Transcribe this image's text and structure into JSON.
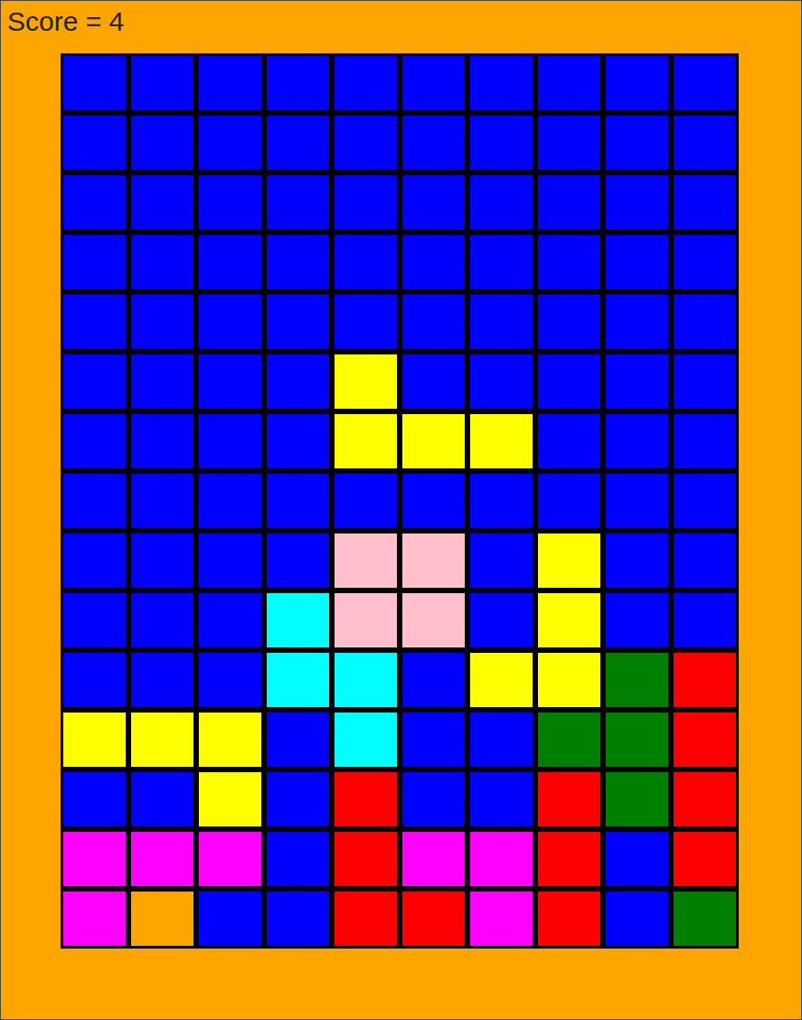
{
  "score": "Score = 4",
  "board": {
    "rows": [
      [
        "#0000ff",
        "#0000ff",
        "#0000ff",
        "#0000ff",
        "#0000ff",
        "#0000ff",
        "#0000ff",
        "#0000ff",
        "#0000ff",
        "#0000ff"
      ],
      [
        "#0000ff",
        "#0000ff",
        "#0000ff",
        "#0000ff",
        "#0000ff",
        "#0000ff",
        "#0000ff",
        "#0000ff",
        "#0000ff",
        "#0000ff"
      ],
      [
        "#0000ff",
        "#0000ff",
        "#0000ff",
        "#0000ff",
        "#0000ff",
        "#0000ff",
        "#0000ff",
        "#0000ff",
        "#0000ff",
        "#0000ff"
      ],
      [
        "#0000ff",
        "#0000ff",
        "#0000ff",
        "#0000ff",
        "#0000ff",
        "#0000ff",
        "#0000ff",
        "#0000ff",
        "#0000ff",
        "#0000ff"
      ],
      [
        "#0000ff",
        "#0000ff",
        "#0000ff",
        "#0000ff",
        "#0000ff",
        "#0000ff",
        "#0000ff",
        "#0000ff",
        "#0000ff",
        "#0000ff"
      ],
      [
        "#0000ff",
        "#0000ff",
        "#0000ff",
        "#0000ff",
        "#ffff00",
        "#0000ff",
        "#0000ff",
        "#0000ff",
        "#0000ff",
        "#0000ff"
      ],
      [
        "#0000ff",
        "#0000ff",
        "#0000ff",
        "#0000ff",
        "#ffff00",
        "#ffff00",
        "#ffff00",
        "#0000ff",
        "#0000ff",
        "#0000ff"
      ],
      [
        "#0000ff",
        "#0000ff",
        "#0000ff",
        "#0000ff",
        "#0000ff",
        "#0000ff",
        "#0000ff",
        "#0000ff",
        "#0000ff",
        "#0000ff"
      ],
      [
        "#0000ff",
        "#0000ff",
        "#0000ff",
        "#0000ff",
        "#ffc0cb",
        "#ffc0cb",
        "#0000ff",
        "#ffff00",
        "#0000ff",
        "#0000ff"
      ],
      [
        "#0000ff",
        "#0000ff",
        "#0000ff",
        "#00ffff",
        "#ffc0cb",
        "#ffc0cb",
        "#0000ff",
        "#ffff00",
        "#0000ff",
        "#0000ff"
      ],
      [
        "#0000ff",
        "#0000ff",
        "#0000ff",
        "#00ffff",
        "#00ffff",
        "#0000ff",
        "#ffff00",
        "#ffff00",
        "#008000",
        "#ff0000"
      ],
      [
        "#ffff00",
        "#ffff00",
        "#ffff00",
        "#0000ff",
        "#00ffff",
        "#0000ff",
        "#0000ff",
        "#008000",
        "#008000",
        "#ff0000"
      ],
      [
        "#0000ff",
        "#0000ff",
        "#ffff00",
        "#0000ff",
        "#ff0000",
        "#0000ff",
        "#0000ff",
        "#ff0000",
        "#008000",
        "#ff0000"
      ],
      [
        "#ff00ff",
        "#ff00ff",
        "#ff00ff",
        "#0000ff",
        "#ff0000",
        "#ff00ff",
        "#ff00ff",
        "#ff0000",
        "#0000ff",
        "#ff0000"
      ],
      [
        "#ff00ff",
        "#ffa500",
        "#0000ff",
        "#0000ff",
        "#ff0000",
        "#ff0000",
        "#ff00ff",
        "#ff0000",
        "#0000ff",
        "#008000"
      ]
    ]
  }
}
